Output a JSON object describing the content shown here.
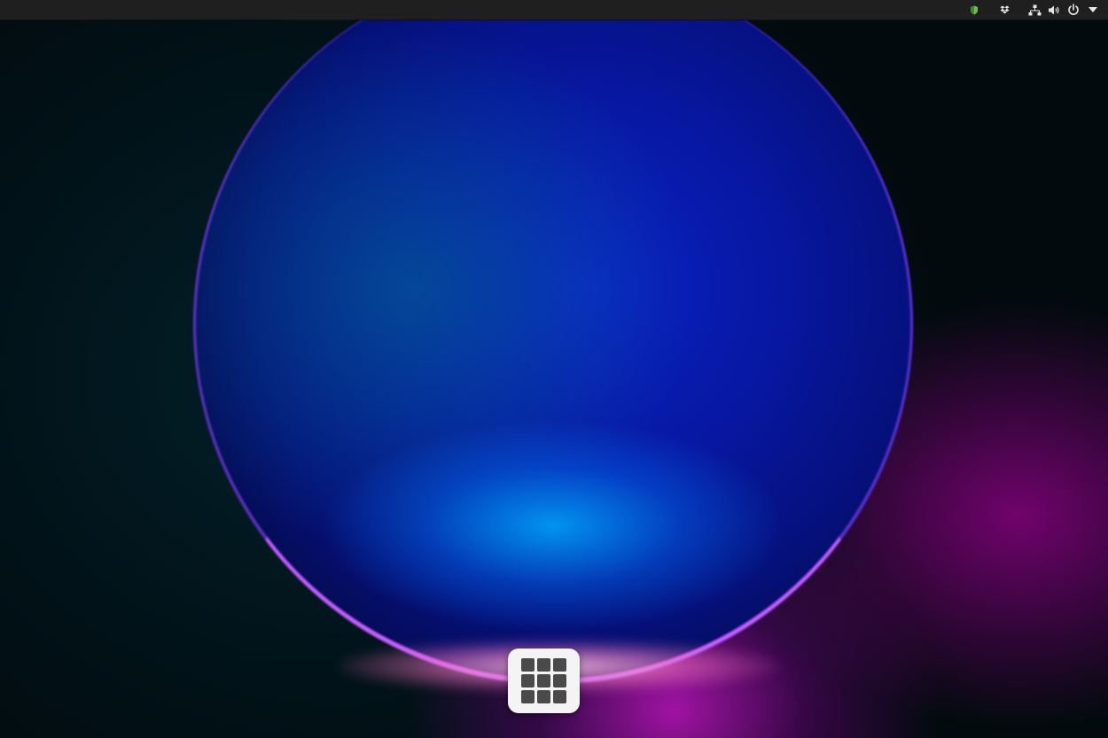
{
  "top_panel": {
    "tray_icons": [
      "shield-icon",
      "dropbox-icon",
      "network-icon",
      "volume-icon",
      "power-icon",
      "chevron-down-icon"
    ]
  },
  "desktop": {
    "wallpaper": "abstract-glowing-orb"
  },
  "dock": {
    "app_grid_icon": "app-grid-icon"
  },
  "colors": {
    "panel_bg": "#1f1f1f",
    "tray_icon": "#e6e6e6",
    "shield_green": "#6fbf4a",
    "dock_button_bg": "#f4f4f4",
    "grid_square": "#4a4a4a"
  }
}
